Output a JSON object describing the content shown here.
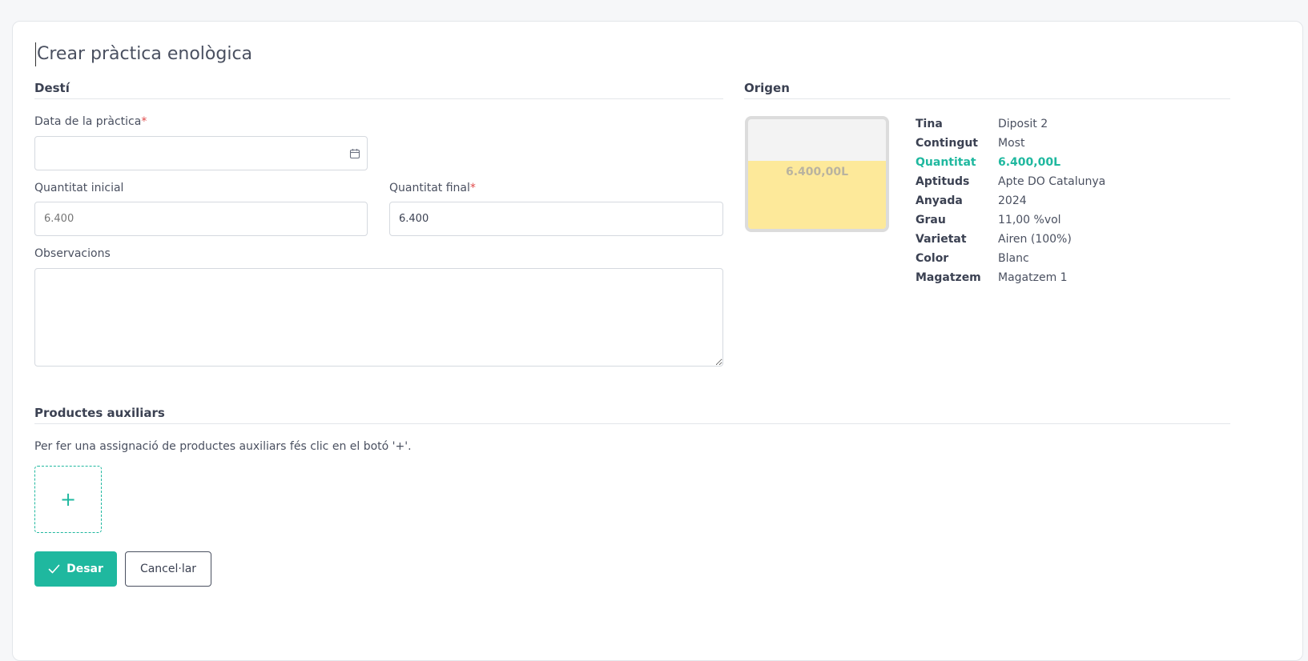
{
  "page": {
    "title": "Crear pràctica enològica"
  },
  "destination": {
    "section_title": "Destí",
    "date_label": "Data de la pràctica",
    "required_mark": "*",
    "date_value": "",
    "initial_label": "Quantitat inicial",
    "initial_value": "6.400",
    "final_label": "Quantitat final",
    "final_value": "6.400",
    "notes_label": "Observacions",
    "notes_value": ""
  },
  "origin": {
    "section_title": "Origen",
    "tank_label": "6.400,00L",
    "tank_fill_fraction": 0.62,
    "details": [
      {
        "key": "Tina",
        "value": "Diposit 2"
      },
      {
        "key": "Contingut",
        "value": "Most"
      },
      {
        "key": "Quantitat",
        "value": "6.400,00L"
      },
      {
        "key": "Aptituds",
        "value": "Apte DO Catalunya"
      },
      {
        "key": "Anyada",
        "value": "2024"
      },
      {
        "key": "Grau",
        "value": "11,00 %vol"
      },
      {
        "key": "Varietat",
        "value": "Airen (100%)"
      },
      {
        "key": "Color",
        "value": "Blanc"
      },
      {
        "key": "Magatzem",
        "value": "Magatzem 1"
      }
    ]
  },
  "auxiliary": {
    "section_title": "Productes auxiliars",
    "hint": "Per fer una assignació de productes auxiliars fés clic en el botó '+'.",
    "add_label": "+"
  },
  "actions": {
    "save_label": "Desar",
    "cancel_label": "Cancel·lar"
  },
  "colors": {
    "accent": "#1fb89f",
    "required": "#e04b4b",
    "tank_liquid": "#fde99a",
    "tank_empty": "#f3f3f3"
  },
  "icons": {
    "date_field": "calendar-icon",
    "save_button": "check-icon"
  }
}
